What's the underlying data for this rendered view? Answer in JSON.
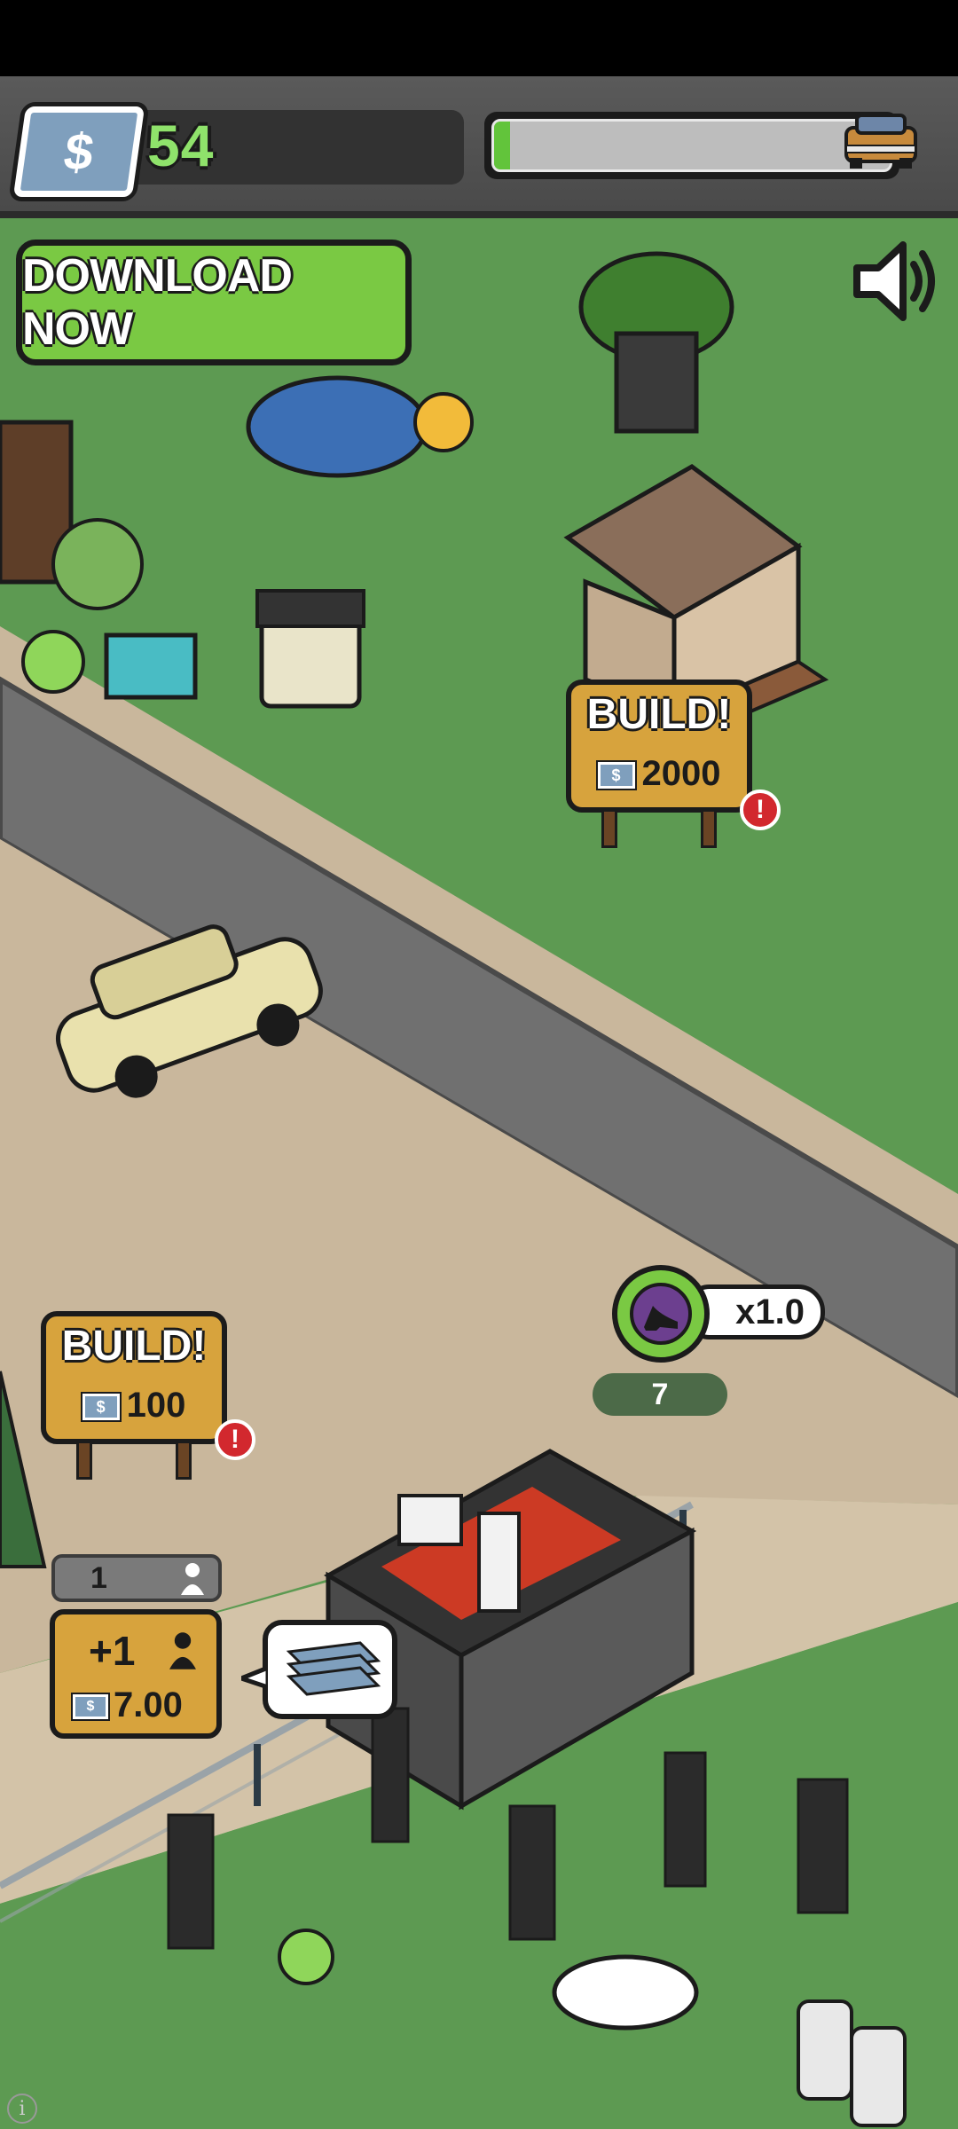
{
  "hud": {
    "money": "54",
    "money_icon": "dollar-bill-icon",
    "progress_fraction": 0.04,
    "progress_icon": "car-icon"
  },
  "download_button": {
    "label": "DOWNLOAD NOW"
  },
  "sound_icon": "speaker-icon",
  "build_signs": [
    {
      "title": "BUILD!",
      "cost": "2000"
    },
    {
      "title": "BUILD!",
      "cost": "100"
    }
  ],
  "attraction": {
    "icon": "high-heel-icon",
    "multiplier": "x1.0",
    "level": "7"
  },
  "workers": {
    "count": "1",
    "hire_label": "+1",
    "hire_cost": "7.00"
  },
  "colors": {
    "money_text": "#8fe26b",
    "progress_fill": "#62c43b",
    "download_green": "#7ac943",
    "sign_wood": "#d7a33d",
    "grass": "#5d9a52",
    "road": "#707070",
    "alert_red": "#d2282e"
  }
}
